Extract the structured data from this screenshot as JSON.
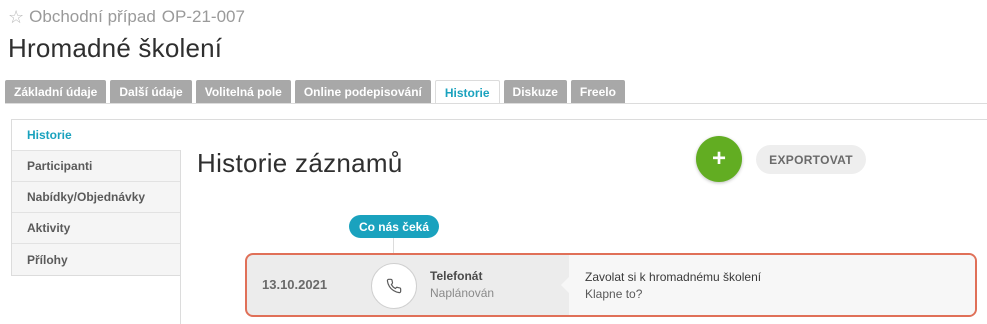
{
  "header": {
    "star_icon": "star-outline-icon",
    "case_label": "Obchodní případ",
    "case_code": "OP-21-007",
    "title": "Hromadné školení"
  },
  "tabs": [
    {
      "label": "Základní údaje"
    },
    {
      "label": "Další údaje"
    },
    {
      "label": "Volitelná pole"
    },
    {
      "label": "Online podepisování"
    },
    {
      "label": "Historie",
      "active": true
    },
    {
      "label": "Diskuze"
    },
    {
      "label": "Freelo"
    }
  ],
  "sidebar": {
    "items": [
      {
        "label": "Historie",
        "active": true
      },
      {
        "label": "Participanti"
      },
      {
        "label": "Nabídky/Objednávky"
      },
      {
        "label": "Aktivity"
      },
      {
        "label": "Přílohy"
      }
    ]
  },
  "main": {
    "title": "Historie záznamů",
    "add_label": "+",
    "export_label": "EXPORTOVAT",
    "badge": "Co nás čeká",
    "record": {
      "date": "13.10.2021",
      "icon": "phone-icon",
      "type": "Telefonát",
      "status": "Naplánován",
      "description": "Zavolat si k hromadnému školení",
      "note": "Klapne to?"
    }
  },
  "colors": {
    "accent": "#1aa2be",
    "add_button": "#62ad22",
    "highlight_border": "#e07058",
    "tab_inactive": "#a8a8a8"
  }
}
